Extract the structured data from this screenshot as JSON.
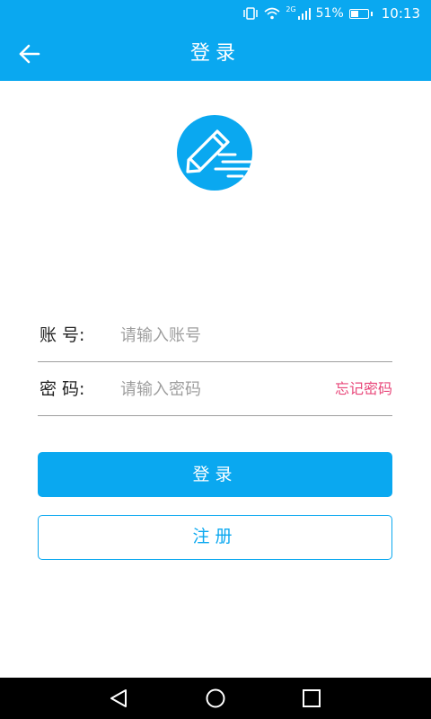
{
  "status_bar": {
    "network": "2G",
    "battery_percent": "51%",
    "battery_level": 0.51,
    "time": "10:13",
    "icons": [
      "vibrate-icon",
      "wifi-icon",
      "cell-signal-icon",
      "battery-icon"
    ]
  },
  "app_bar": {
    "title": "登录",
    "back_icon": "arrow-left-icon",
    "background": "#0aa8f0"
  },
  "logo": {
    "icon": "pencil-logo-icon",
    "color": "#0aa8f0"
  },
  "form": {
    "account": {
      "label": "账 号:",
      "placeholder": "请输入账号",
      "value": ""
    },
    "password": {
      "label": "密 码:",
      "placeholder": "请输入密码",
      "value": "",
      "forgot_label": "忘记密码"
    }
  },
  "buttons": {
    "login_label": "登录",
    "register_label": "注册"
  },
  "colors": {
    "accent": "#0aa8f0",
    "link": "#e8477a",
    "divider": "#9e9e9e"
  },
  "nav_bar": {
    "icons": [
      "nav-back-icon",
      "nav-home-icon",
      "nav-recent-icon"
    ]
  }
}
